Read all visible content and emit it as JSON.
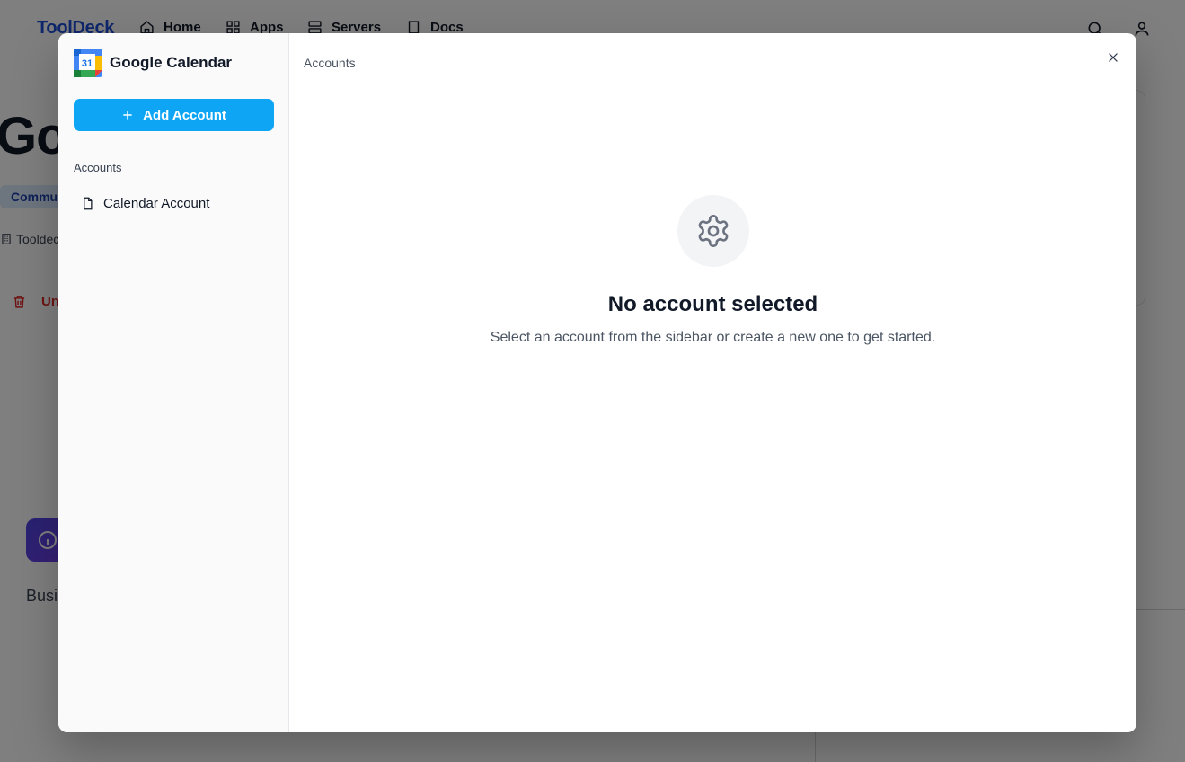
{
  "background": {
    "logo": "ToolDeck",
    "nav": [
      {
        "label": "Home",
        "icon": "home-icon"
      },
      {
        "label": "Apps",
        "icon": "apps-icon"
      },
      {
        "label": "Servers",
        "icon": "servers-icon"
      },
      {
        "label": "Docs",
        "icon": "docs-icon"
      }
    ],
    "page_title_fragment": "Go",
    "badge_fragment": "Commu",
    "meta_fragment": "Tooldec",
    "uninstall_fragment": "Uni",
    "section_fragment": "Busi"
  },
  "modal": {
    "app_name": "Google Calendar",
    "app_icon_number": "31",
    "add_account_label": "Add Account",
    "accounts_section_label": "Accounts",
    "accounts": [
      {
        "label": "Calendar Account"
      }
    ],
    "breadcrumb": "Accounts",
    "empty_title": "No account selected",
    "empty_description": "Select an account from the sidebar or create a new one to get started."
  },
  "colors": {
    "accent": "#0ea5f5",
    "brand": "#1d4ed8",
    "danger": "#dc2626"
  }
}
